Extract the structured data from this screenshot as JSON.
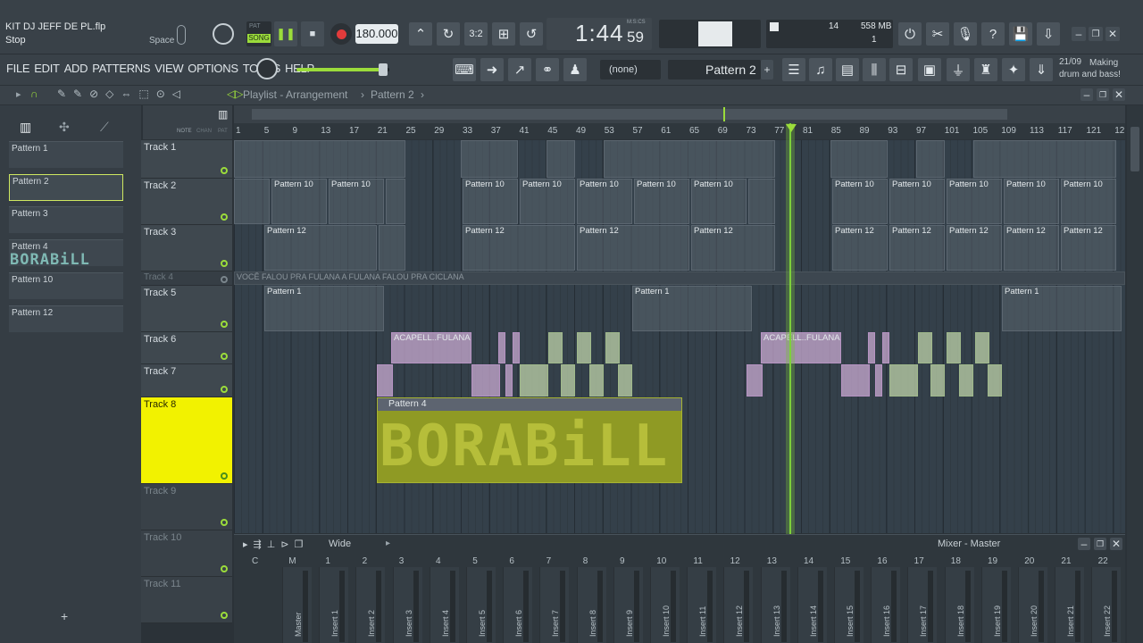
{
  "file": {
    "title": "KIT DJ JEFF DE PL.flp",
    "status": "Stop",
    "hint": "Space"
  },
  "transport": {
    "mode": "SONG",
    "mode_top": "PAT",
    "tempo": "180.000",
    "time": "1:44",
    "time_sub": "59",
    "time_unit": "M:S:CS"
  },
  "monitor": {
    "cpu": "14",
    "mem": "558 MB",
    "poly": "1"
  },
  "menu": [
    "FILE",
    "EDIT",
    "ADD",
    "PATTERNS",
    "VIEW",
    "OPTIONS",
    "TOOLS",
    "HELP"
  ],
  "toolbar": {
    "snap": "(none)",
    "pattern": "Pattern 2",
    "news_date": "21/09",
    "news": "Making drum and bass!"
  },
  "playlist": {
    "title": "Playlist - Arrangement",
    "sep": "›",
    "pattern": "Pattern 2",
    "sep2": "›"
  },
  "tool_labels": {
    "note": "NOTE",
    "chan": "CHAN",
    "pat": "PAT"
  },
  "patterns": [
    {
      "name": "Pattern 1"
    },
    {
      "name": "Pattern 2"
    },
    {
      "name": "Pattern 3"
    },
    {
      "name": "Pattern 4"
    },
    {
      "name": "Pattern 10"
    },
    {
      "name": "Pattern 12"
    }
  ],
  "pattern4_art": "BORABiLL",
  "ruler": [
    "1",
    "5",
    "9",
    "13",
    "17",
    "21",
    "25",
    "29",
    "33",
    "37",
    "41",
    "45",
    "49",
    "53",
    "57",
    "61",
    "65",
    "69",
    "73",
    "77",
    "81",
    "85",
    "89",
    "93",
    "97",
    "101",
    "105",
    "109",
    "113",
    "117",
    "121",
    "12"
  ],
  "tracks": [
    "Track 1",
    "Track 2",
    "Track 3",
    "Track 4",
    "Track 5",
    "Track 6",
    "Track 7",
    "Track 8",
    "Track 9",
    "Track 10",
    "Track 11"
  ],
  "track4_audio": "VOCÊ FALOU PRA FULANA A FULANA FALOU PRA CICLANA",
  "clips": {
    "p10": "Pattern 10",
    "p12": "Pattern 12",
    "p1": "Pattern 1",
    "p4": "Pattern 4",
    "acap": "ACAPELL..FULANA",
    "art": "BORABiLL!!!"
  },
  "mixer": {
    "title": "Wide",
    "header": "Mixer - Master",
    "cols": [
      "C",
      "M",
      "1",
      "2",
      "3",
      "4",
      "5",
      "6",
      "7",
      "8",
      "9",
      "10",
      "11",
      "12",
      "13",
      "14",
      "15",
      "16",
      "17",
      "18",
      "19",
      "20",
      "21",
      "22"
    ],
    "strips": [
      "Master",
      "Insert 1",
      "Insert 2",
      "Insert 3",
      "Insert 4",
      "Insert 5",
      "Insert 6",
      "Insert 7",
      "Insert 8",
      "Insert 9",
      "Insert 10",
      "Insert 11",
      "Insert 12",
      "Insert 13",
      "Insert 14",
      "Insert 15",
      "Insert 16",
      "Insert 17",
      "Insert 18",
      "Insert 19",
      "Insert 20",
      "Insert 21",
      "Insert 22"
    ]
  },
  "colors": {
    "accent": "#7ed03b",
    "track8": "#f2f200",
    "record": "#e23b3b"
  }
}
